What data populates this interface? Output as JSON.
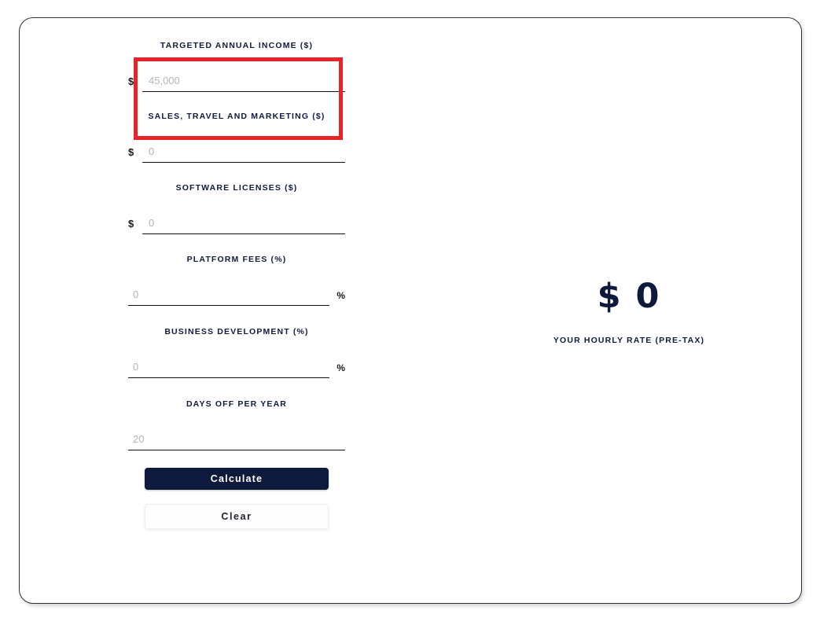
{
  "card": {
    "result": {
      "value": "$ 0",
      "label": "Your Hourly Rate (Pre-Tax)"
    },
    "buttons": {
      "calculate": "Calculate",
      "clear": "Clear"
    },
    "fields": [
      {
        "label": "Targeted Annual Income ($)",
        "prefix": "$",
        "suffix": "",
        "value": "",
        "placeholder": "45,000"
      },
      {
        "label": "Sales, Travel and Marketing ($)",
        "prefix": "$",
        "suffix": "",
        "value": "",
        "placeholder": "0"
      },
      {
        "label": "Software Licenses ($)",
        "prefix": "$",
        "suffix": "",
        "value": "",
        "placeholder": "0"
      },
      {
        "label": "Platform Fees (%)",
        "prefix": "",
        "suffix": "%",
        "value": "",
        "placeholder": "0"
      },
      {
        "label": "Business Development (%)",
        "prefix": "",
        "suffix": "%",
        "value": "",
        "placeholder": "0"
      },
      {
        "label": "Days Off Per Year",
        "prefix": "",
        "suffix": "",
        "value": "",
        "placeholder": "20"
      }
    ]
  },
  "annotation": {
    "highlight_color": "#e8232a",
    "target_field": "Targeted Annual Income ($)"
  },
  "colors": {
    "accent_navy": "#0e1a3c",
    "highlight_red": "#e8232a",
    "placeholder_gray": "#b4b4b4"
  }
}
